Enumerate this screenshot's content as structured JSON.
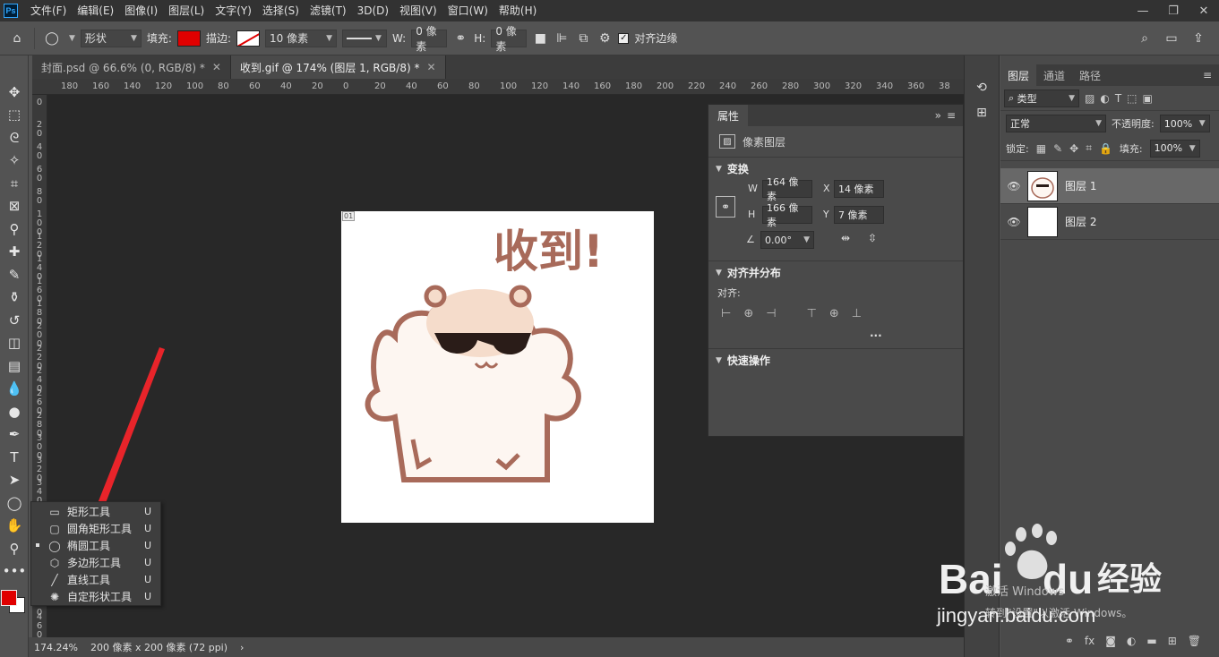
{
  "menubar": {
    "logo": "Ps",
    "items": [
      "文件(F)",
      "编辑(E)",
      "图像(I)",
      "图层(L)",
      "文字(Y)",
      "选择(S)",
      "滤镜(T)",
      "3D(D)",
      "视图(V)",
      "窗口(W)",
      "帮助(H)"
    ]
  },
  "options": {
    "mode": "形状",
    "fill_label": "填充:",
    "fill_color": "#e00000",
    "stroke_label": "描边:",
    "stroke_width": "10 像素",
    "w_label": "W:",
    "w_value": "0 像素",
    "h_label": "H:",
    "h_value": "0 像素",
    "align_edges_label": "对齐边缘"
  },
  "tabs": [
    {
      "label": "封面.psd @ 66.6% (0, RGB/8) *",
      "active": false
    },
    {
      "label": "收到.gif @ 174% (图层 1, RGB/8) *",
      "active": true
    }
  ],
  "ruler": {
    "h_ticks": [
      "180",
      "160",
      "140",
      "120",
      "100",
      "80",
      "60",
      "40",
      "20",
      "0",
      "20",
      "40",
      "60",
      "80",
      "100",
      "120",
      "140",
      "160",
      "180",
      "200",
      "220",
      "240",
      "260",
      "280",
      "300",
      "320",
      "340",
      "360",
      "38"
    ],
    "v_ticks": [
      "0",
      "2 0",
      "4 0",
      "6 0",
      "8 0",
      "1 0 0",
      "1 2 0",
      "1 4 0",
      "1 6 0",
      "1 8 0",
      "2 0 0",
      "2 2 0",
      "2 4 0",
      "2 6 0",
      "2 8 0",
      "3 0 0",
      "3 2 0",
      "3 4 0",
      "3 6 0",
      "3 8 0",
      "4 0 0",
      "4 2 0",
      "4 4 0",
      "4 6 0"
    ]
  },
  "document": {
    "frame_badge": "01",
    "sticker_text": "收到!",
    "sticker_colors": {
      "outline": "#a86a5a",
      "face": "#f5dccb",
      "glasses": "#2a1c18",
      "text": "#a86a5a"
    }
  },
  "flyout": {
    "items": [
      {
        "label": "矩形工具",
        "key": "U",
        "icon": "rectangle-icon"
      },
      {
        "label": "圆角矩形工具",
        "key": "U",
        "icon": "rounded-rectangle-icon"
      },
      {
        "label": "椭圆工具",
        "key": "U",
        "icon": "ellipse-icon",
        "active": true
      },
      {
        "label": "多边形工具",
        "key": "U",
        "icon": "polygon-icon"
      },
      {
        "label": "直线工具",
        "key": "U",
        "icon": "line-icon"
      },
      {
        "label": "自定形状工具",
        "key": "U",
        "icon": "custom-shape-icon"
      }
    ]
  },
  "status": {
    "zoom": "174.24%",
    "doc_info": "200 像素 x 200 像素 (72 ppi)"
  },
  "properties": {
    "tab": "属性",
    "layer_type": "像素图层",
    "transform_title": "变换",
    "w_label": "W",
    "w_value": "164 像素",
    "x_label": "X",
    "x_value": "14 像素",
    "h_label": "H",
    "h_value": "166 像素",
    "y_label": "Y",
    "y_value": "7 像素",
    "angle_value": "0.00°",
    "align_title": "对齐并分布",
    "align_label": "对齐:",
    "quick_title": "快速操作",
    "more": "..."
  },
  "layers": {
    "tabs": [
      "图层",
      "通道",
      "路径"
    ],
    "filter": "类型",
    "blend_mode": "正常",
    "opacity_label": "不透明度:",
    "opacity_value": "100%",
    "lock_label": "锁定:",
    "fill_label": "填充:",
    "fill_value": "100%",
    "items": [
      {
        "name": "图层 1",
        "selected": true
      },
      {
        "name": "图层 2",
        "selected": false
      }
    ]
  },
  "watermark": {
    "brand": "Bai",
    "brand2": "du",
    "brand_cn": "经验",
    "url": "jingyan.baidu.com",
    "activate_line1": "激活 Windows",
    "activate_line2": "转到\"设置\"以激活 Windows。"
  },
  "colors": {
    "foreground": "#e00000",
    "background": "#ffffff",
    "annotation_arrow": "#e8242a"
  }
}
